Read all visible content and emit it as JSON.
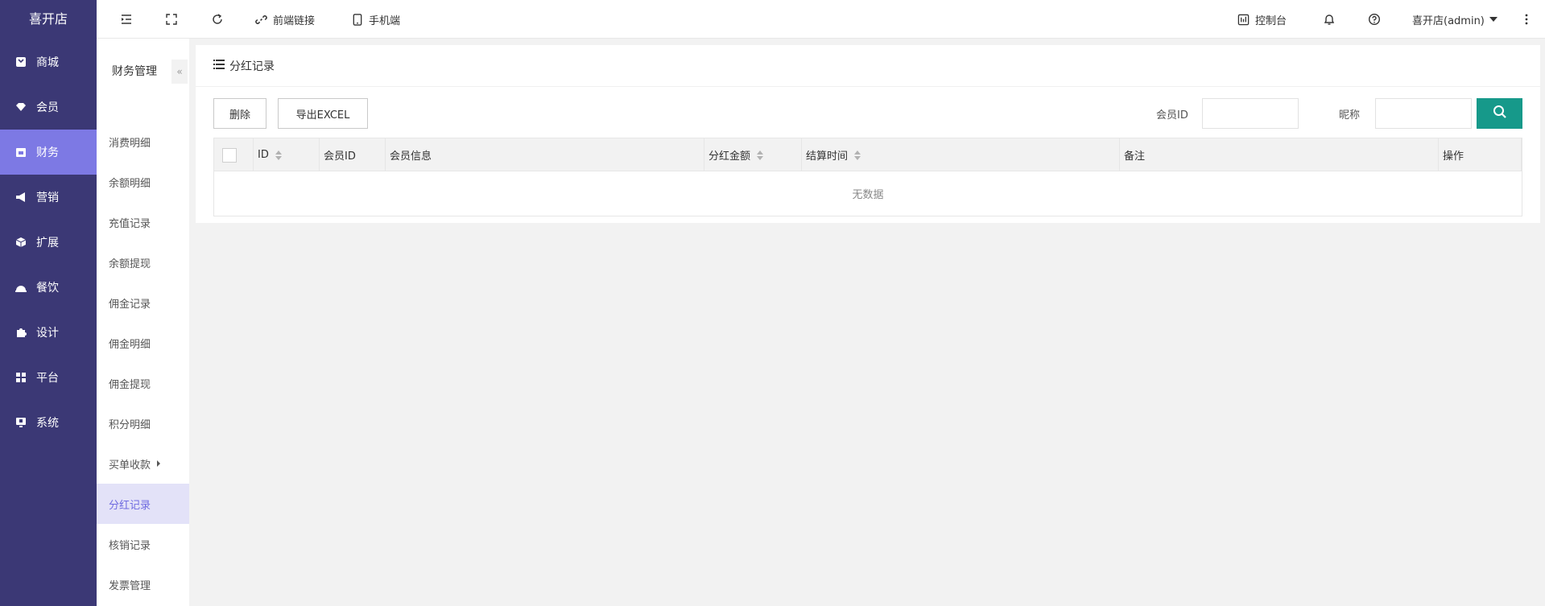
{
  "app": {
    "brand": "喜开店"
  },
  "sidebar": {
    "items": [
      {
        "label": "商城",
        "icon": "store-icon"
      },
      {
        "label": "会员",
        "icon": "gem-icon"
      },
      {
        "label": "财务",
        "icon": "wallet-icon",
        "active": true
      },
      {
        "label": "营销",
        "icon": "megaphone-icon"
      },
      {
        "label": "扩展",
        "icon": "cube-icon"
      },
      {
        "label": "餐饮",
        "icon": "dish-icon"
      },
      {
        "label": "设计",
        "icon": "puzzle-icon"
      },
      {
        "label": "平台",
        "icon": "grid-icon"
      },
      {
        "label": "系统",
        "icon": "monitor-icon"
      }
    ]
  },
  "submenu": {
    "title": "财务管理",
    "collapse_glyph": "«",
    "items": [
      {
        "label": "消费明细"
      },
      {
        "label": "余额明细"
      },
      {
        "label": "充值记录"
      },
      {
        "label": "余额提现"
      },
      {
        "label": "佣金记录"
      },
      {
        "label": "佣金明细"
      },
      {
        "label": "佣金提现"
      },
      {
        "label": "积分明细"
      },
      {
        "label": "买单收款"
      },
      {
        "label": "分红记录"
      },
      {
        "label": "核销记录"
      },
      {
        "label": "发票管理"
      }
    ]
  },
  "topbar": {
    "frontend_link": "前端链接",
    "mobile": "手机端",
    "console": "控制台",
    "user": "喜开店(admin)"
  },
  "card": {
    "title": "分红记录",
    "toolbar": {
      "delete_label": "删除",
      "export_label": "导出EXCEL",
      "member_id_label": "会员ID",
      "nickname_label": "昵称",
      "member_id_value": "",
      "nickname_value": ""
    },
    "table": {
      "columns": [
        "ID",
        "会员ID",
        "会员信息",
        "分红金额",
        "结算时间",
        "备注",
        "操作"
      ],
      "empty_text": "无数据"
    }
  },
  "colors": {
    "sidebar": "#3b3875",
    "sidebar_active": "#7d79e4",
    "submenu_active_text": "#6f6be0",
    "search_button": "#16998a"
  }
}
